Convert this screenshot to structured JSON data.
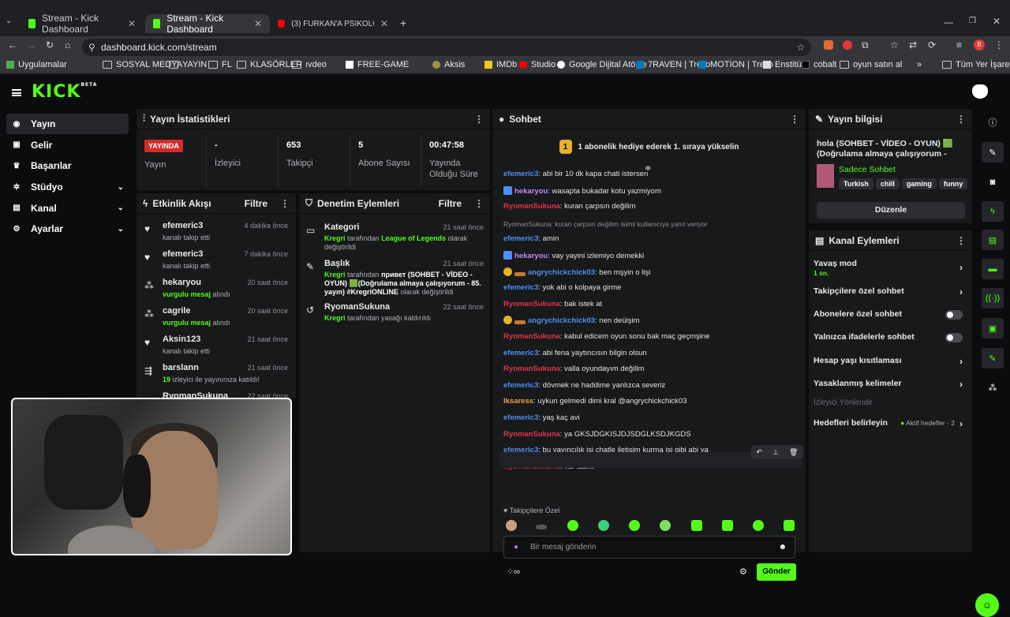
{
  "browser": {
    "tabs": [
      {
        "title": "Stream - Kick Dashboard"
      },
      {
        "title": "Stream - Kick Dashboard"
      },
      {
        "title": "(3) FURKAN'A PSİKOLOJİK KIŞK..."
      }
    ],
    "url": "dashboard.kick.com/stream",
    "bookmarks": [
      "Uygulamalar",
      "SOSYAL MEDYA",
      "YAYIN",
      "FL",
      "KLASÖRLER",
      "ıvdeo",
      "FREE-GAME",
      "Aksis",
      "IMDb",
      "Studio",
      "Google Dijital Atölye",
      "7RAVEN | Trello",
      "MOTİON | Trello",
      "Enstitü",
      "cobalt",
      "oyun satın al",
      "Tüm Yer İşaretleri"
    ]
  },
  "brand": {
    "logo": "KICK",
    "beta": "BETA"
  },
  "nav": {
    "items": [
      {
        "label": "Yayın"
      },
      {
        "label": "Gelir"
      },
      {
        "label": "Başarılar"
      },
      {
        "label": "Stüdyo"
      },
      {
        "label": "Kanal"
      },
      {
        "label": "Ayarlar"
      }
    ]
  },
  "stats": {
    "title": "Yayın İstatistikleri",
    "live_label": "YAYINDA",
    "stream_label": "Yayın",
    "viewers_value": "-",
    "viewers_label": "İzleyici",
    "followers_value": "653",
    "followers_label": "Takipçi",
    "subs_value": "5",
    "subs_label": "Abone Sayısı",
    "duration_value": "00:47:58",
    "duration_label": "Yayında Olduğu Süre"
  },
  "activity": {
    "title": "Etkinlik Akışı",
    "filter": "Filtre",
    "items": [
      {
        "name": "efemeric3",
        "desc": "kanalı takip etti",
        "time": "4 dakika önce"
      },
      {
        "name": "efemeric3",
        "desc": "kanalı takip etti",
        "time": "7 dakika önce"
      },
      {
        "name": "hekaryou",
        "hl": "vurgulu mesaj",
        "desc": " alındı",
        "time": "20 saat önce"
      },
      {
        "name": "cagrile",
        "hl": "vurgulu mesaj",
        "desc": " alındı",
        "time": "20 saat önce"
      },
      {
        "name": "Aksin123",
        "desc": "kanalı takip etti",
        "time": "21 saat önce"
      },
      {
        "name": "barslann",
        "hl": "19",
        "desc": " izleyici ile yayınınıza katıldı!",
        "time": "21 saat önce"
      },
      {
        "name": "RyomanSukuna",
        "desc": "",
        "time": "22 saat önce"
      }
    ]
  },
  "moderation": {
    "title": "Denetim Eylemleri",
    "filter": "Filtre",
    "items": [
      {
        "title": "Kategori",
        "time": "21 saat önce",
        "who": "Kregri",
        "t1": " tarafından ",
        "hl": "League of Legends",
        "t2": " olarak değiştirildi"
      },
      {
        "title": "Başlık",
        "time": "21 saat önce",
        "who": "Kregri",
        "t1": " tarafından ",
        "hl": "привет (SOHBET - VİDEO - OYUN) 🟩(Doğrulama almaya çalışıyorum - 85. yayın) #KregriONLINE",
        "t2": " olarak değiştirildi"
      },
      {
        "title": "RyomanSukuna",
        "time": "22 saat önce",
        "who": "Kregri",
        "t1": " tarafından yasağı kaldırıldı",
        "hl": "",
        "t2": ""
      }
    ]
  },
  "chat": {
    "title": "Sohbet",
    "pinned_badge": "1",
    "pinned": "1 abonelik hediye ederek 1. sıraya yükselin",
    "messages": [
      {
        "user": "efemeric3",
        "color": "blue",
        "text": ": abi bir 10 dk kapa chati istersen"
      },
      {
        "user": "hekaryou",
        "color": "purple",
        "text": ": wasapta bukadar kotu yazmiyom",
        "badge": true
      },
      {
        "user": "RyomanSukuna",
        "color": "red",
        "text": ": kuran çarpsın değilim"
      },
      {
        "user": "",
        "color": "gray",
        "text": "RyomanSukuna: kuran çarpsın değilim isimli kullanıcıya yanıt veriyor",
        "reply": true
      },
      {
        "user": "efemeric3",
        "color": "blue",
        "text": ": amin"
      },
      {
        "user": "hekaryou",
        "color": "purple",
        "text": ": vay yayini izlemiyo demekki",
        "badge": true
      },
      {
        "user": "angrychickchick03",
        "color": "blue",
        "text": ": ben mşyin o lişi",
        "gold": true
      },
      {
        "user": "efemeric3",
        "color": "blue",
        "text": ": yok abi o kolpaya girme"
      },
      {
        "user": "RyomanSukuna",
        "color": "red",
        "text": ": bak istek at"
      },
      {
        "user": "angrychickchick03",
        "color": "blue",
        "text": ": nen deüişim",
        "gold": true
      },
      {
        "user": "RyomanSukuna",
        "color": "red",
        "text": ": kabul edicem oyun sonu bak maç geçmşine"
      },
      {
        "user": "efemeric3",
        "color": "blue",
        "text": ": abi fena yaytıncısın bilgin olsun"
      },
      {
        "user": "RyomanSukuna",
        "color": "red",
        "text": ": valla oyundayım değilim"
      },
      {
        "user": "efemeric3",
        "color": "blue",
        "text": ": dövmek ne haddime yanlızca severiz"
      },
      {
        "user": "lksaress",
        "color": "orange",
        "text": ": uykun gelmedi dimi kral @angrychickchick03"
      },
      {
        "user": "efemeric3",
        "color": "blue",
        "text": ": yaş kaç avi"
      },
      {
        "user": "RyomanSukuna",
        "color": "red",
        "text": ": ya GKSJDGKISJDJSDGLKSDJKGDS"
      },
      {
        "user": "efemeric3",
        "color": "blue",
        "text": ": bu yayıncılık işi chatle iletişim kurma işi gibi abi ya"
      },
      {
        "user": "RyomanSukuna",
        "color": "red",
        "text": ": var tabiki"
      }
    ],
    "emote_section": "Takipçilere Özel",
    "input_placeholder": "Bir mesaj gönderin",
    "send_label": "Gönder"
  },
  "stream_info": {
    "title": "Yayın bilgisi",
    "stream_title": "hola (SOHBET - VİDEO - OYUN) 🟩(Doğrulama almaya çalışıyorum - 86....",
    "category": "Sadece Sohbet",
    "tags": [
      "Turkish",
      "chill",
      "gaming",
      "funny"
    ],
    "edit_label": "Düzenle"
  },
  "channel_actions": {
    "title": "Kanal Eylemleri",
    "slow_mode": "Yavaş mod",
    "slow_mode_value": "1 sn.",
    "followers_only": "Takipçilere özel sohbet",
    "subs_only": "Abonelere özel sohbet",
    "emote_only": "Yalnızca ifadelerle sohbet",
    "account_age": "Hesap yaşı kısıtlaması",
    "banned_words": "Yasaklanmış kelimeler",
    "viewer_redirect": "İzleyici Yönlendir",
    "set_targets": "Hedefleri belirleyin",
    "active_targets": "Aktif hedefler - 2"
  },
  "colors": {
    "accent": "#53fc18",
    "live": "#d12c2c",
    "panel": "#18191b"
  }
}
